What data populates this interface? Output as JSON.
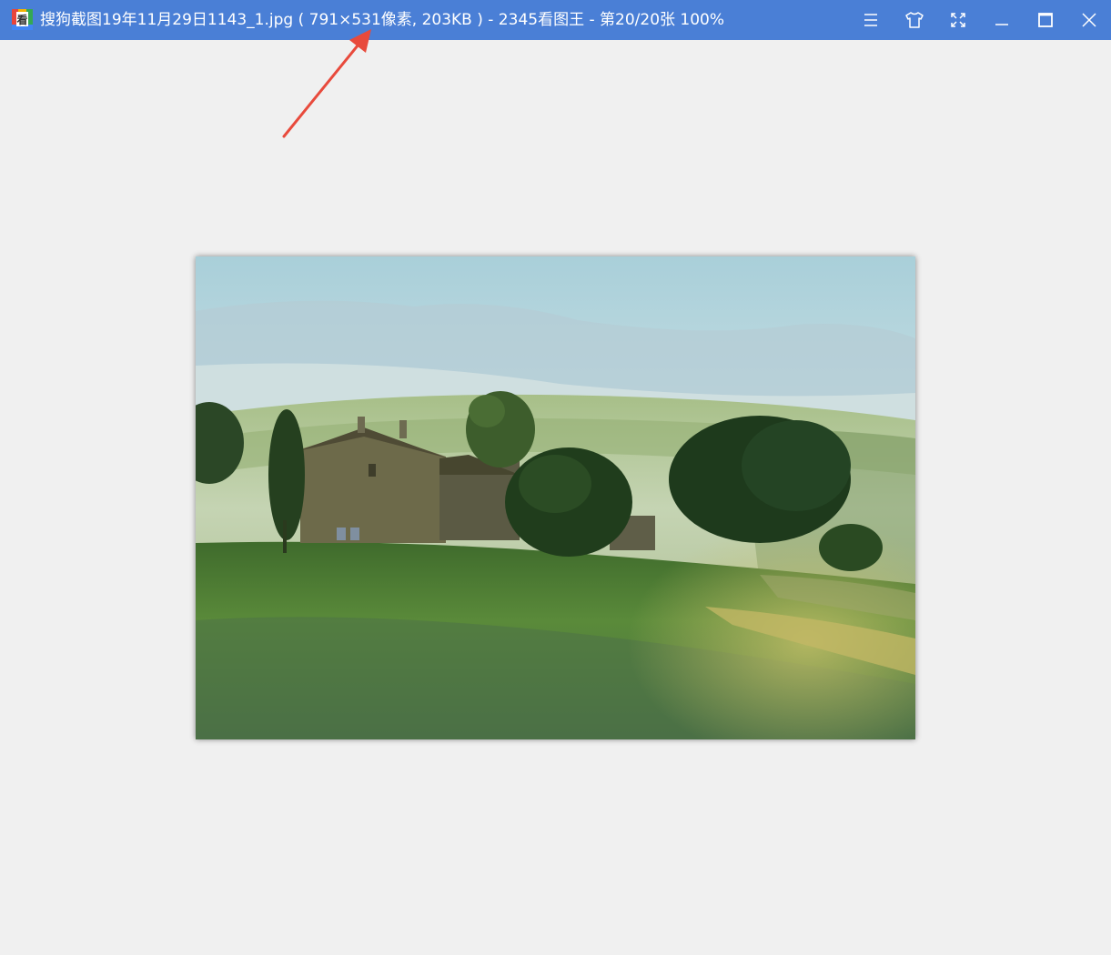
{
  "window": {
    "title": "搜狗截图19年11月29日1143_1.jpg ( 791×531像素, 203KB ) - 2345看图王 - 第20/20张 100%",
    "titlebar_color": "#4a7fd6"
  },
  "controls": {
    "menu_icon": "menu-icon",
    "skin_icon": "tshirt-icon",
    "fullscreen_icon": "fullscreen-icon",
    "minimize_icon": "minimize-icon",
    "maximize_icon": "maximize-icon",
    "close_icon": "close-icon"
  },
  "annotation": {
    "arrow_color": "#e84a3c"
  }
}
